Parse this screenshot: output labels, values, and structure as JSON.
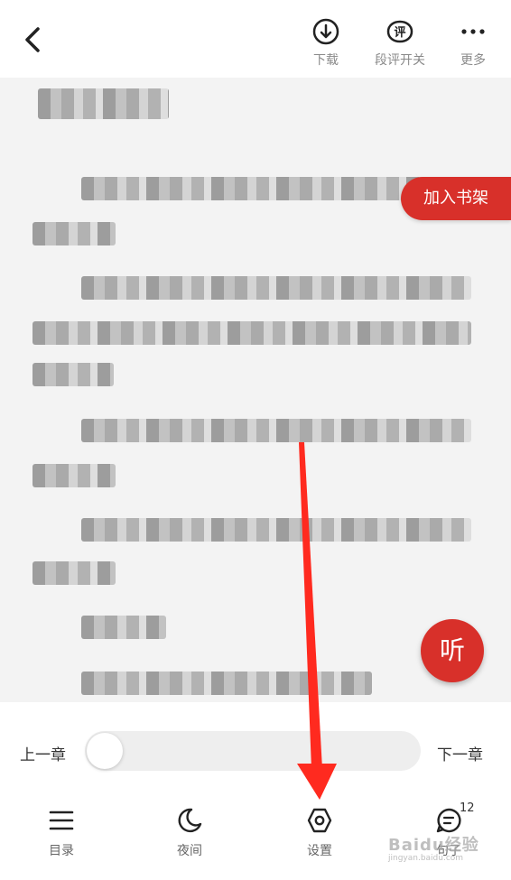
{
  "top_bar": {
    "actions": [
      {
        "label": "下载",
        "icon": "download-icon"
      },
      {
        "label": "段评开关",
        "icon": "comment-toggle-icon",
        "icon_glyph": "评"
      },
      {
        "label": "更多",
        "icon": "more-icon"
      }
    ]
  },
  "reader": {
    "add_shelf_label": "加入书架",
    "listen_label": "听"
  },
  "chapter_bar": {
    "prev_label": "上一章",
    "next_label": "下一章",
    "progress": 0
  },
  "bottom_nav": {
    "items": [
      {
        "label": "目录",
        "icon": "menu-list-icon"
      },
      {
        "label": "夜间",
        "icon": "moon-icon"
      },
      {
        "label": "设置",
        "icon": "settings-hexagon-icon"
      },
      {
        "label": "句子",
        "icon": "comment-bubble-icon",
        "badge": "12"
      }
    ]
  },
  "watermark": {
    "text": "Baidu经验",
    "sub": "jingyan.baidu.com"
  },
  "colors": {
    "accent": "#d8302a",
    "reader_bg": "#f3f3f3",
    "arrow": "#ff2a1f"
  }
}
